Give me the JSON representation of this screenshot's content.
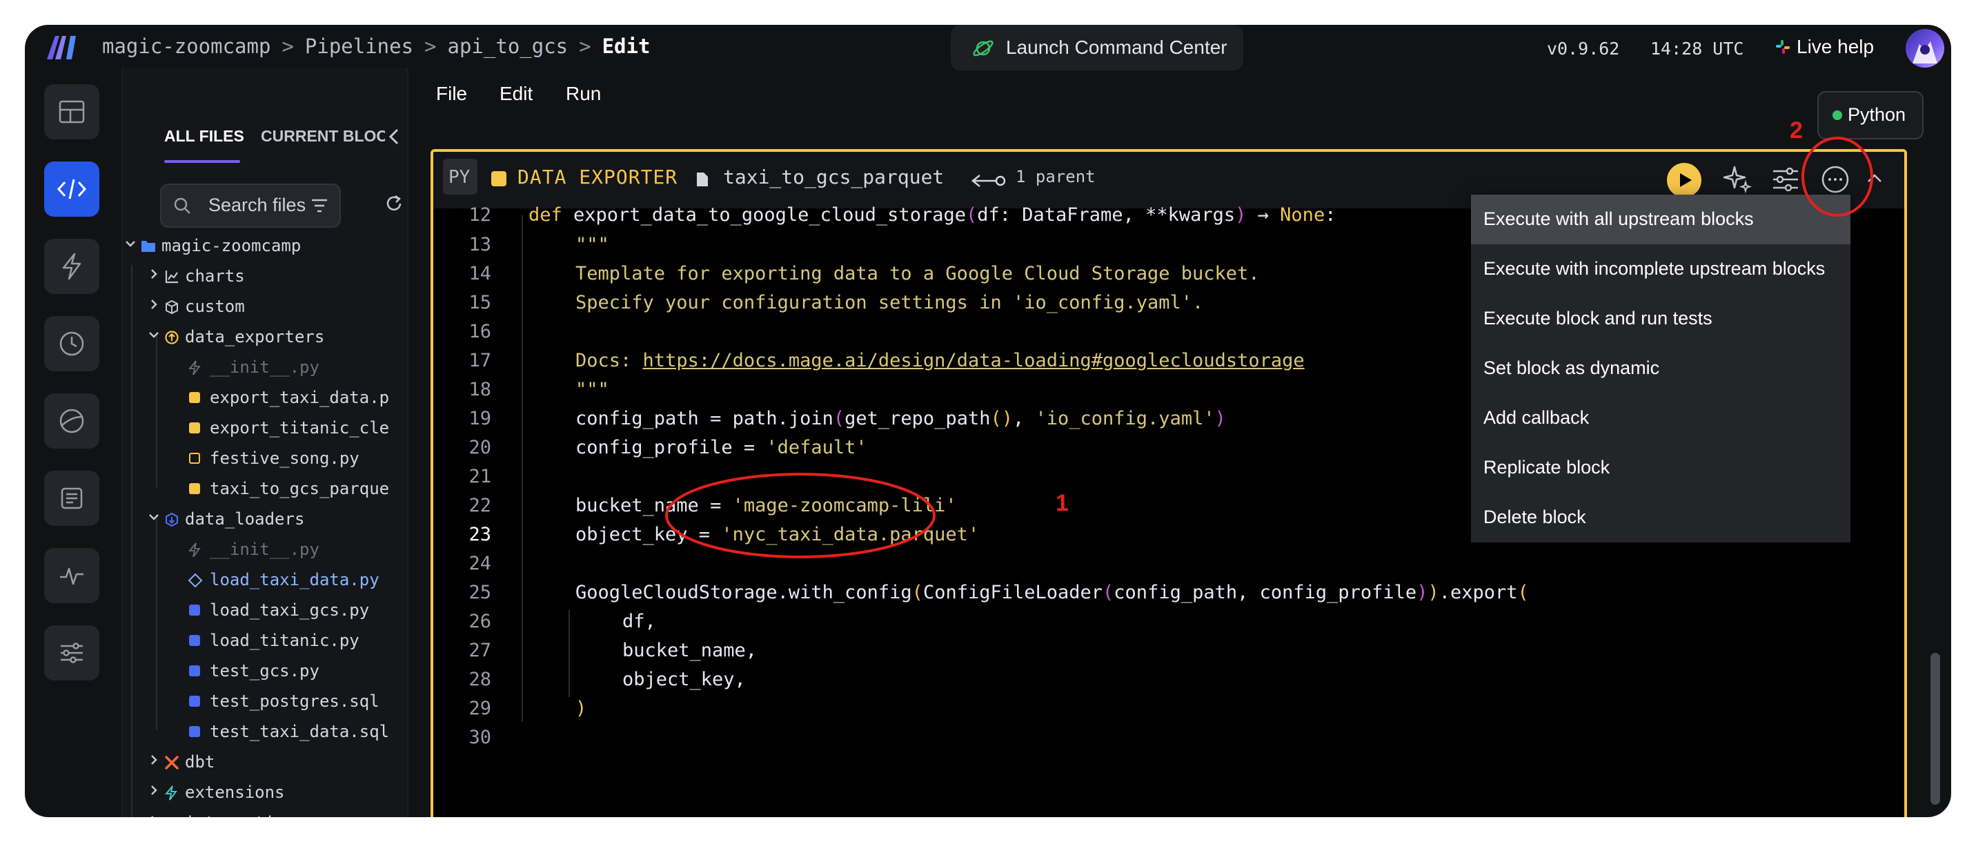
{
  "topbar": {
    "breadcrumb": [
      "magic-zoomcamp",
      "Pipelines",
      "api_to_gcs",
      "Edit"
    ],
    "command_center_label": "Launch Command Center",
    "version": "v0.9.62",
    "time": "14:28 UTC",
    "live_help": "Live help"
  },
  "file_panel": {
    "tab_all": "ALL FILES",
    "tab_current": "CURRENT BLOCK",
    "search_placeholder": "Search files",
    "tree": {
      "root": "magic-zoomcamp",
      "charts": "charts",
      "custom": "custom",
      "data_exporters": "data_exporters",
      "exporters": [
        "__init__.py",
        "export_taxi_data.p",
        "export_titanic_cle",
        "festive_song.py",
        "taxi_to_gcs_parque"
      ],
      "data_loaders": "data_loaders",
      "loaders": [
        "__init__.py",
        "load_taxi_data.py",
        "load_taxi_gcs.py",
        "load_titanic.py",
        "test_gcs.py",
        "test_postgres.sql",
        "test_taxi_data.sql"
      ],
      "dbt": "dbt",
      "extensions": "extensions",
      "interactions": "interactions"
    }
  },
  "editor": {
    "menu": [
      "File",
      "Edit",
      "Run"
    ],
    "language_badge": "Python",
    "block": {
      "lang_tag": "PY",
      "type_label": "DATA EXPORTER",
      "name": "taxi_to_gcs_parquet",
      "parents": "1 parent"
    },
    "line_numbers": [
      "12",
      "13",
      "14",
      "15",
      "16",
      "17",
      "18",
      "19",
      "20",
      "21",
      "22",
      "23",
      "24",
      "25",
      "26",
      "27",
      "28",
      "29",
      "30"
    ],
    "code": {
      "l12_def": "def ",
      "l12_fn": "export_data_to_google_cloud_storage",
      "l12_args": "df: DataFrame, **kwargs",
      "l12_arrow": " → ",
      "l12_none": "None",
      "l12_colon": ":",
      "l13": "\"\"\"",
      "l14": "Template for exporting data to a Google Cloud Storage bucket.",
      "l15": "Specify your configuration settings in 'io_config.yaml'.",
      "l17_prefix": "Docs: ",
      "l17_url": "https://docs.mage.ai/design/data-loading#googlecloudstorage",
      "l18": "\"\"\"",
      "l19_a": "config_path = path.join",
      "l19_b": "get_repo_path",
      "l19_c": ", ",
      "l19_str": "'io_config.yaml'",
      "l20_a": "config_profile = ",
      "l20_str": "'default'",
      "l22_a": "bucket_name = ",
      "l22_str": "'mage-zoomcamp-lili'",
      "l23_a": "object_key = ",
      "l23_str": "'nyc_taxi_data.parquet'",
      "l25_a": "GoogleCloudStorage.with_config",
      "l25_b": "ConfigFileLoader",
      "l25_c": "config_path, config_profile",
      "l25_d": ".export",
      "l26": "df,",
      "l27": "bucket_name,",
      "l28": "object_key,"
    },
    "dropdown": [
      "Execute with all upstream blocks",
      "Execute with incomplete upstream blocks",
      "Execute block and run tests",
      "Set block as dynamic",
      "Add callback",
      "Replicate block",
      "Delete block"
    ]
  },
  "annotations": {
    "one": "1",
    "two": "2"
  },
  "colors": {
    "accent": "#f5c64a",
    "nav_active": "#2458e8",
    "annotation": "#e4211c",
    "loader_blue": "#4a6cf0"
  }
}
